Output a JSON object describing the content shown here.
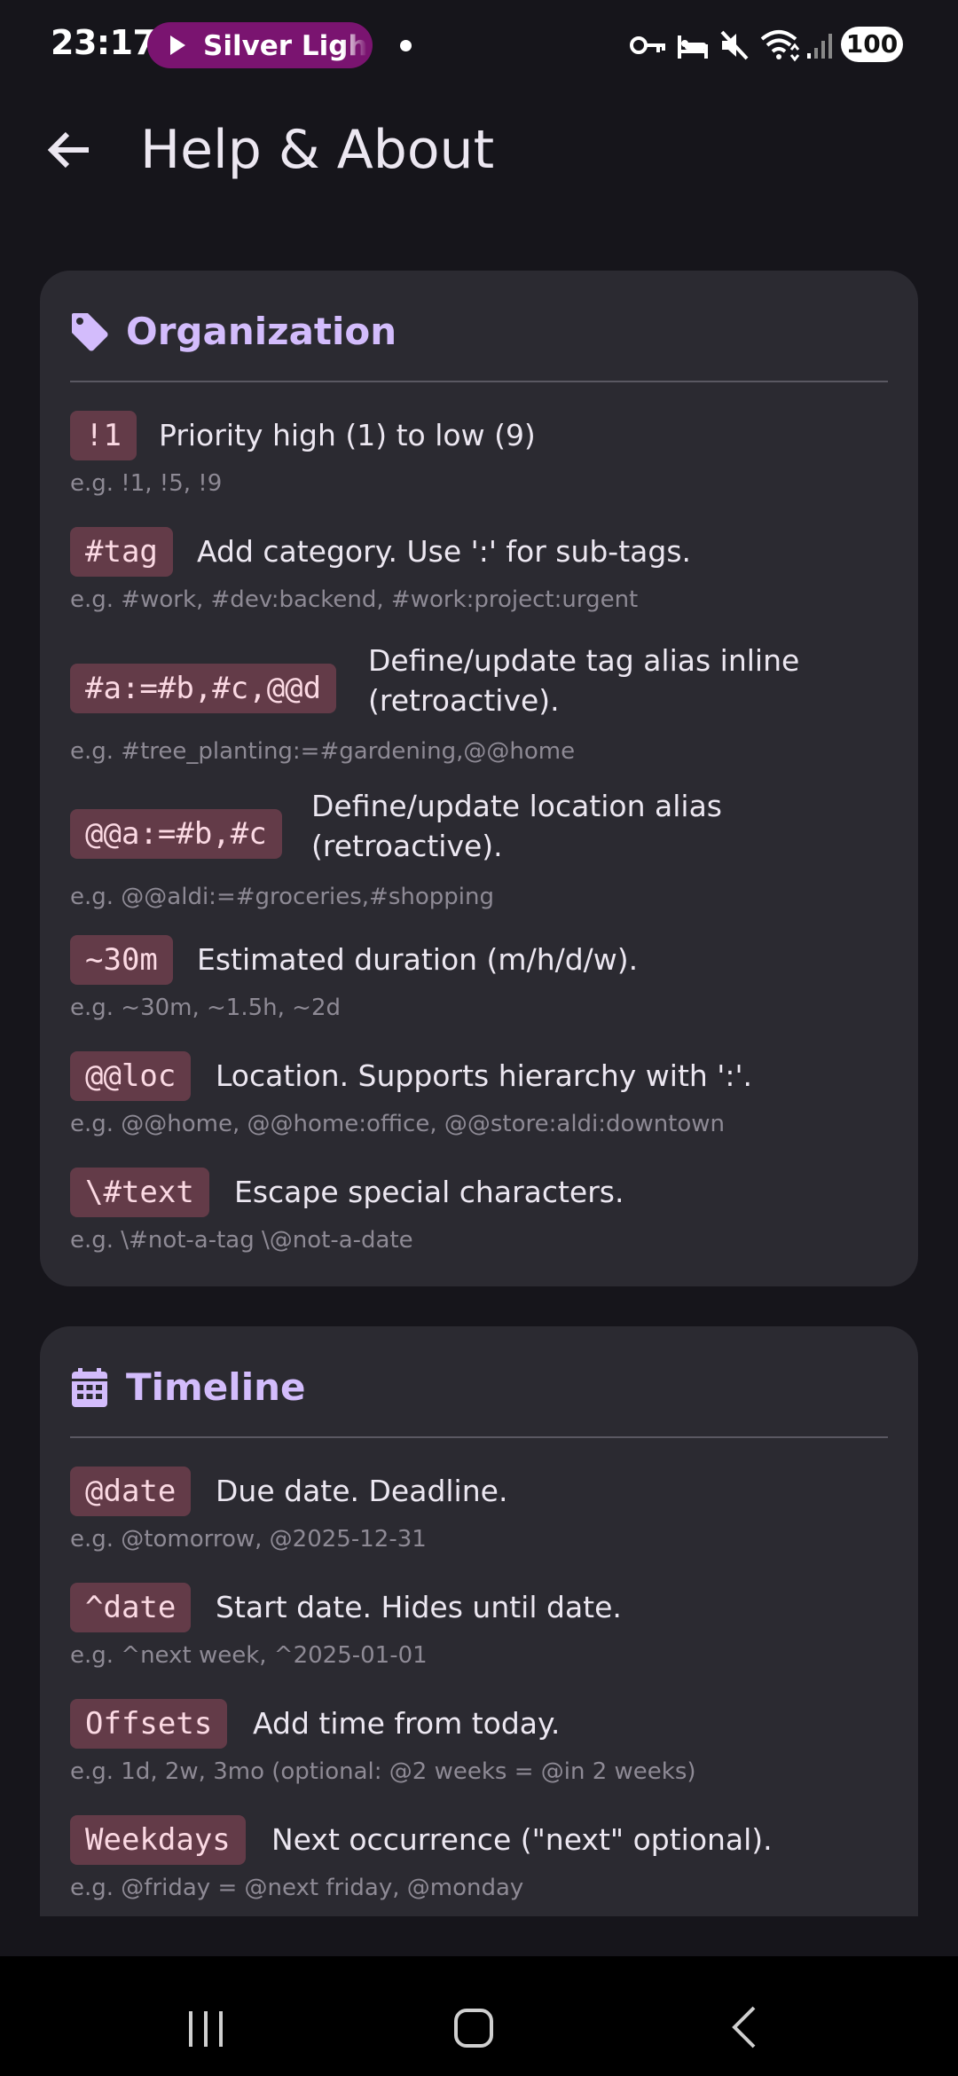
{
  "status_bar": {
    "time": "23:17",
    "media_label": "Silver Light",
    "battery": "100"
  },
  "app_bar": {
    "title": "Help & About"
  },
  "sections": [
    {
      "title": "Organization",
      "icon": "tag-icon",
      "entries": [
        {
          "code": "!1",
          "desc": "Priority high (1) to low (9)",
          "example": "e.g. !1, !5, !9"
        },
        {
          "code": "#tag",
          "desc": "Add category. Use ':' for sub-tags.",
          "example": "e.g. #work, #dev:backend, #work:project:urgent"
        },
        {
          "code": "#a:=#b,#c,@@d",
          "desc": "Define/update tag alias inline (retroactive).",
          "example": "e.g. #tree_planting:=#gardening,@@home"
        },
        {
          "code": "@@a:=#b,#c",
          "desc": "Define/update location alias (retroactive).",
          "example": "e.g. @@aldi:=#groceries,#shopping"
        },
        {
          "code": "~30m",
          "desc": "Estimated duration (m/h/d/w).",
          "example": "e.g. ~30m, ~1.5h, ~2d"
        },
        {
          "code": "@@loc",
          "desc": "Location. Supports hierarchy with ':'.",
          "example": "e.g. @@home, @@home:office, @@store:aldi:downtown"
        },
        {
          "code": "\\#text",
          "desc": "Escape special characters.",
          "example": "e.g. \\#not-a-tag \\@not-a-date"
        }
      ]
    },
    {
      "title": "Timeline",
      "icon": "calendar-icon",
      "entries": [
        {
          "code": "@date",
          "desc": "Due date. Deadline.",
          "example": "e.g. @tomorrow, @2025-12-31"
        },
        {
          "code": "^date",
          "desc": "Start date. Hides until date.",
          "example": "e.g. ^next week, ^2025-01-01"
        },
        {
          "code": "Offsets",
          "desc": "Add time from today.",
          "example": "e.g. 1d, 2w, 3mo (optional: @2 weeks = @in 2 weeks)"
        },
        {
          "code": "Weekdays",
          "desc": "Next occurrence (\"next\" optional).",
          "example": "e.g. @friday = @next friday, @monday"
        }
      ]
    }
  ],
  "colors": {
    "background": "#16151b",
    "card": "#2b2a31",
    "accent": "#d3bcfc",
    "chip_bg": "#633b48",
    "chip_text": "#fbd9e3",
    "muted": "#8e8a95",
    "media_pill": "#7a1470"
  }
}
